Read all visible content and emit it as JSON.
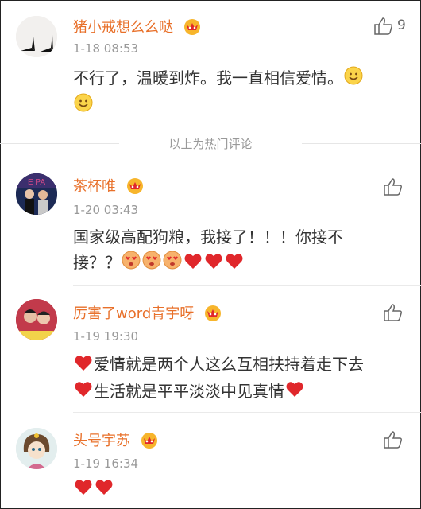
{
  "hot_divider": "以上为热门评论",
  "comments": [
    {
      "username": "猪小戒想么么哒",
      "time": "1-18 08:53",
      "text_line1": "不行了，温暖到炸。我一直相信爱情。",
      "likes": "9"
    },
    {
      "username": "茶杯唯",
      "time": "1-20 03:43",
      "text_line1": "国家级高配狗粮，我接了！！！你接不",
      "text_line2": "接？？"
    },
    {
      "username": "厉害了word青宇呀",
      "time": "1-19 19:30",
      "text_line1": "爱情就是两个人这么互相扶持着走下去",
      "text_line2": "生活就是平平淡淡中见真情"
    },
    {
      "username": "头号宇苏",
      "time": "1-19 16:34"
    }
  ],
  "colors": {
    "username": "#e8702a",
    "heart": "#e0272b",
    "muted": "#999999"
  }
}
